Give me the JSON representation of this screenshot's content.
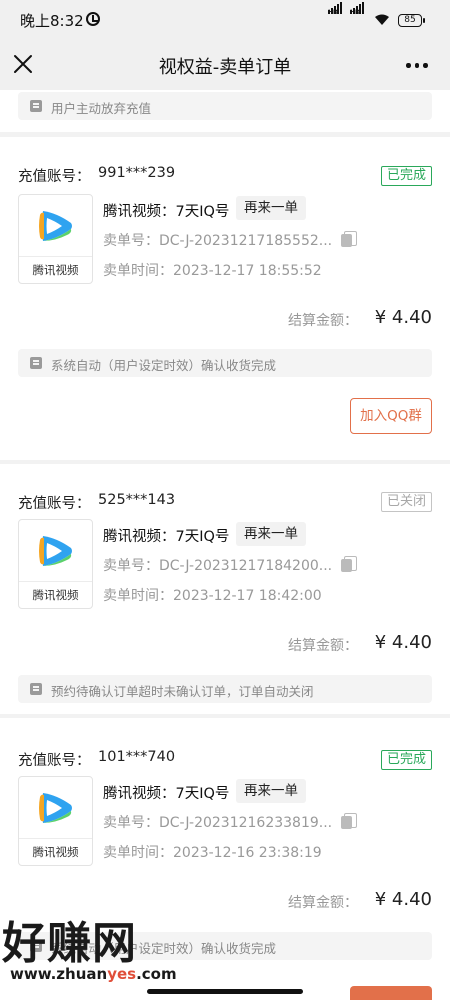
{
  "status_bar": {
    "time": "晚上8:32",
    "battery": "85"
  },
  "nav": {
    "title": "视权益-卖单订单"
  },
  "top_notice": {
    "text": "用户主动放弃充值"
  },
  "labels": {
    "account": "充值账号：",
    "order_no": "卖单号：",
    "order_time": "卖单时间：",
    "settle": "结算金额：",
    "reorder": "再来一单",
    "join_qq": "加入QQ群",
    "thumb_label": "腾讯视频"
  },
  "orders": [
    {
      "account": "991***239",
      "status": "已完成",
      "product": "腾讯视频：7天IQ号",
      "order_no": "DC-J-20231217185552...",
      "time": "2023-12-17 18:55:52",
      "amount": "¥ 4.40",
      "notice": "系统自动（用户设定时效）确认收货完成"
    },
    {
      "account": "525***143",
      "status": "已关闭",
      "product": "腾讯视频：7天IQ号",
      "order_no": "DC-J-20231217184200...",
      "time": "2023-12-17 18:42:00",
      "amount": "¥ 4.40",
      "notice": "预约待确认订单超时未确认订单，订单自动关闭"
    },
    {
      "account": "101***740",
      "status": "已完成",
      "product": "腾讯视频：7天IQ号",
      "order_no": "DC-J-20231216233819...",
      "time": "2023-12-16 23:38:19",
      "amount": "¥ 4.40",
      "notice": "系统自动（用户设定时效）确认收货完成"
    }
  ],
  "watermark": {
    "big": "好赚网",
    "url_a": "www.zhuan",
    "url_b": "yes",
    "url_c": ".com"
  },
  "colors": {
    "done": "#2aa85a",
    "closed": "#a8a8a8",
    "accent": "#e2704a",
    "logo_blue": "#2fa3f0",
    "logo_green": "#5bd16b",
    "logo_orange": "#f5a623"
  }
}
